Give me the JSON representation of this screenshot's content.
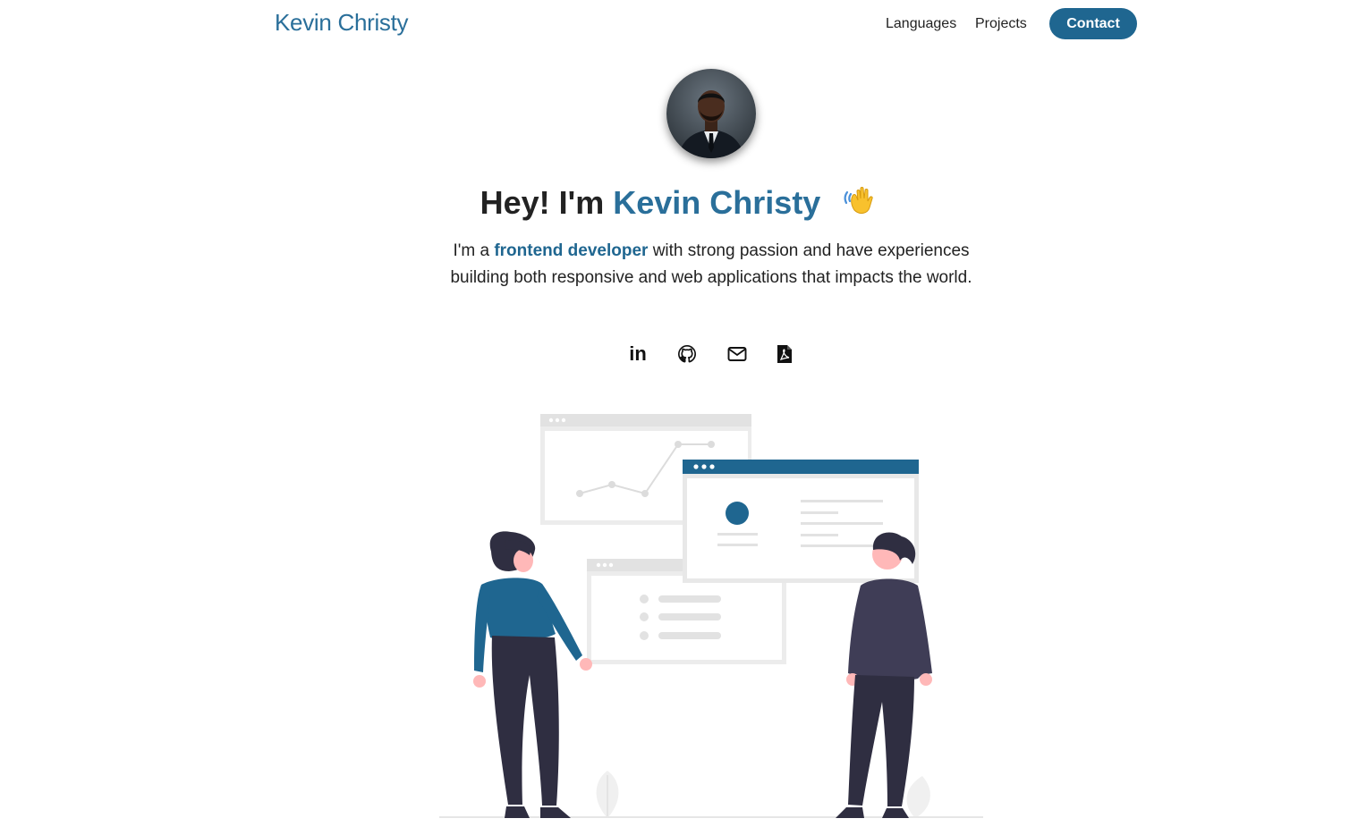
{
  "brand": "Kevin Christy",
  "nav": {
    "languages": "Languages",
    "projects": "Projects",
    "contact": "Contact"
  },
  "hero": {
    "greeting": "Hey! I'm",
    "name": "Kevin Christy",
    "bio_prefix": "I'm a",
    "bio_highlight": "frontend developer",
    "bio_rest": "with strong passion and have experiences building both responsive and web applications that impacts the world."
  },
  "social": {
    "linkedin": "in",
    "icons": [
      "linkedin-icon",
      "github-icon",
      "mail-icon",
      "pdf-icon"
    ]
  },
  "colors": {
    "accent": "#2a6f9a",
    "button": "#1f6690",
    "text": "#222222"
  }
}
